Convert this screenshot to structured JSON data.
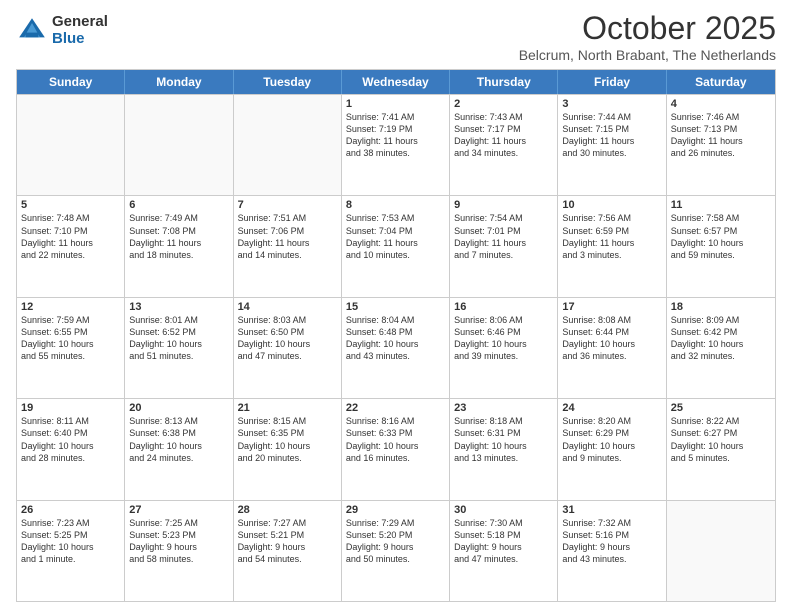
{
  "header": {
    "logo": {
      "general": "General",
      "blue": "Blue"
    },
    "title": "October 2025",
    "location": "Belcrum, North Brabant, The Netherlands"
  },
  "calendar": {
    "days": [
      "Sunday",
      "Monday",
      "Tuesday",
      "Wednesday",
      "Thursday",
      "Friday",
      "Saturday"
    ],
    "rows": [
      [
        {
          "day": "",
          "info": ""
        },
        {
          "day": "",
          "info": ""
        },
        {
          "day": "",
          "info": ""
        },
        {
          "day": "1",
          "info": "Sunrise: 7:41 AM\nSunset: 7:19 PM\nDaylight: 11 hours\nand 38 minutes."
        },
        {
          "day": "2",
          "info": "Sunrise: 7:43 AM\nSunset: 7:17 PM\nDaylight: 11 hours\nand 34 minutes."
        },
        {
          "day": "3",
          "info": "Sunrise: 7:44 AM\nSunset: 7:15 PM\nDaylight: 11 hours\nand 30 minutes."
        },
        {
          "day": "4",
          "info": "Sunrise: 7:46 AM\nSunset: 7:13 PM\nDaylight: 11 hours\nand 26 minutes."
        }
      ],
      [
        {
          "day": "5",
          "info": "Sunrise: 7:48 AM\nSunset: 7:10 PM\nDaylight: 11 hours\nand 22 minutes."
        },
        {
          "day": "6",
          "info": "Sunrise: 7:49 AM\nSunset: 7:08 PM\nDaylight: 11 hours\nand 18 minutes."
        },
        {
          "day": "7",
          "info": "Sunrise: 7:51 AM\nSunset: 7:06 PM\nDaylight: 11 hours\nand 14 minutes."
        },
        {
          "day": "8",
          "info": "Sunrise: 7:53 AM\nSunset: 7:04 PM\nDaylight: 11 hours\nand 10 minutes."
        },
        {
          "day": "9",
          "info": "Sunrise: 7:54 AM\nSunset: 7:01 PM\nDaylight: 11 hours\nand 7 minutes."
        },
        {
          "day": "10",
          "info": "Sunrise: 7:56 AM\nSunset: 6:59 PM\nDaylight: 11 hours\nand 3 minutes."
        },
        {
          "day": "11",
          "info": "Sunrise: 7:58 AM\nSunset: 6:57 PM\nDaylight: 10 hours\nand 59 minutes."
        }
      ],
      [
        {
          "day": "12",
          "info": "Sunrise: 7:59 AM\nSunset: 6:55 PM\nDaylight: 10 hours\nand 55 minutes."
        },
        {
          "day": "13",
          "info": "Sunrise: 8:01 AM\nSunset: 6:52 PM\nDaylight: 10 hours\nand 51 minutes."
        },
        {
          "day": "14",
          "info": "Sunrise: 8:03 AM\nSunset: 6:50 PM\nDaylight: 10 hours\nand 47 minutes."
        },
        {
          "day": "15",
          "info": "Sunrise: 8:04 AM\nSunset: 6:48 PM\nDaylight: 10 hours\nand 43 minutes."
        },
        {
          "day": "16",
          "info": "Sunrise: 8:06 AM\nSunset: 6:46 PM\nDaylight: 10 hours\nand 39 minutes."
        },
        {
          "day": "17",
          "info": "Sunrise: 8:08 AM\nSunset: 6:44 PM\nDaylight: 10 hours\nand 36 minutes."
        },
        {
          "day": "18",
          "info": "Sunrise: 8:09 AM\nSunset: 6:42 PM\nDaylight: 10 hours\nand 32 minutes."
        }
      ],
      [
        {
          "day": "19",
          "info": "Sunrise: 8:11 AM\nSunset: 6:40 PM\nDaylight: 10 hours\nand 28 minutes."
        },
        {
          "day": "20",
          "info": "Sunrise: 8:13 AM\nSunset: 6:38 PM\nDaylight: 10 hours\nand 24 minutes."
        },
        {
          "day": "21",
          "info": "Sunrise: 8:15 AM\nSunset: 6:35 PM\nDaylight: 10 hours\nand 20 minutes."
        },
        {
          "day": "22",
          "info": "Sunrise: 8:16 AM\nSunset: 6:33 PM\nDaylight: 10 hours\nand 16 minutes."
        },
        {
          "day": "23",
          "info": "Sunrise: 8:18 AM\nSunset: 6:31 PM\nDaylight: 10 hours\nand 13 minutes."
        },
        {
          "day": "24",
          "info": "Sunrise: 8:20 AM\nSunset: 6:29 PM\nDaylight: 10 hours\nand 9 minutes."
        },
        {
          "day": "25",
          "info": "Sunrise: 8:22 AM\nSunset: 6:27 PM\nDaylight: 10 hours\nand 5 minutes."
        }
      ],
      [
        {
          "day": "26",
          "info": "Sunrise: 7:23 AM\nSunset: 5:25 PM\nDaylight: 10 hours\nand 1 minute."
        },
        {
          "day": "27",
          "info": "Sunrise: 7:25 AM\nSunset: 5:23 PM\nDaylight: 9 hours\nand 58 minutes."
        },
        {
          "day": "28",
          "info": "Sunrise: 7:27 AM\nSunset: 5:21 PM\nDaylight: 9 hours\nand 54 minutes."
        },
        {
          "day": "29",
          "info": "Sunrise: 7:29 AM\nSunset: 5:20 PM\nDaylight: 9 hours\nand 50 minutes."
        },
        {
          "day": "30",
          "info": "Sunrise: 7:30 AM\nSunset: 5:18 PM\nDaylight: 9 hours\nand 47 minutes."
        },
        {
          "day": "31",
          "info": "Sunrise: 7:32 AM\nSunset: 5:16 PM\nDaylight: 9 hours\nand 43 minutes."
        },
        {
          "day": "",
          "info": ""
        }
      ]
    ]
  }
}
